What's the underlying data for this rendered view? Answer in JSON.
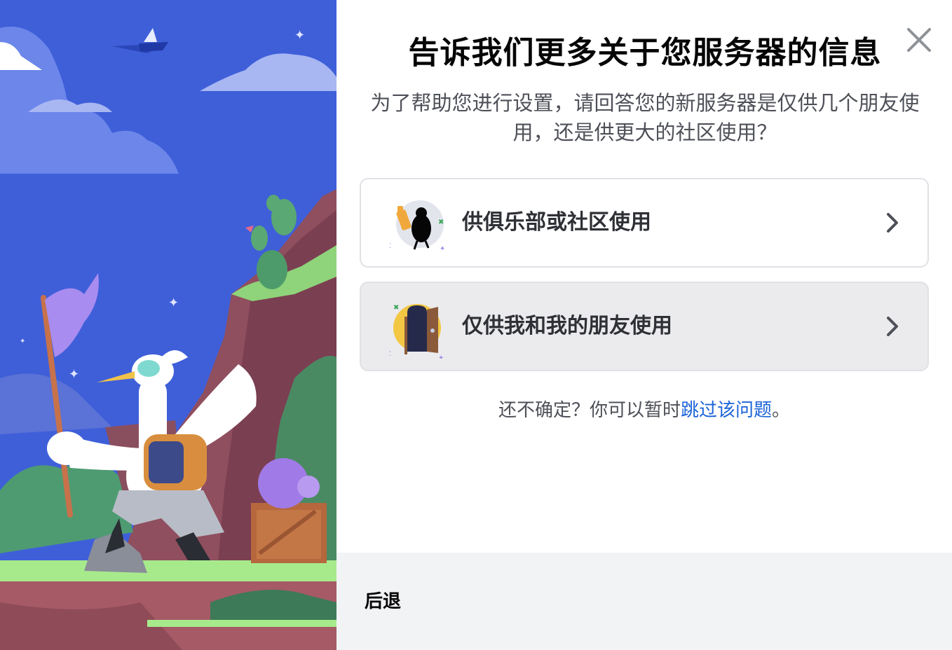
{
  "modal": {
    "title": "告诉我们更多关于您服务器的信息",
    "subtitle": "为了帮助您进行设置，请回答您的新服务器是仅供几个朋友使用，还是供更大的社区使用？",
    "options": [
      {
        "label": "供俱乐部或社区使用",
        "icon": "club-community-icon"
      },
      {
        "label": "仅供我和我的朋友使用",
        "icon": "friends-door-icon"
      }
    ],
    "hint": {
      "prefix": "还不确定？你可以暂时",
      "link": "跳过该问题",
      "suffix": "。"
    },
    "footer": {
      "back_label": "后退"
    },
    "close_icon": "close-icon",
    "chevron_icon": "chevron-right-icon"
  },
  "colors": {
    "link": "#1b63d8",
    "title": "#060607",
    "option_border": "#dfe1e5",
    "option_hover_bg": "#ebebed",
    "footer_bg": "#f2f3f5",
    "sky": "#3f5fd9"
  }
}
